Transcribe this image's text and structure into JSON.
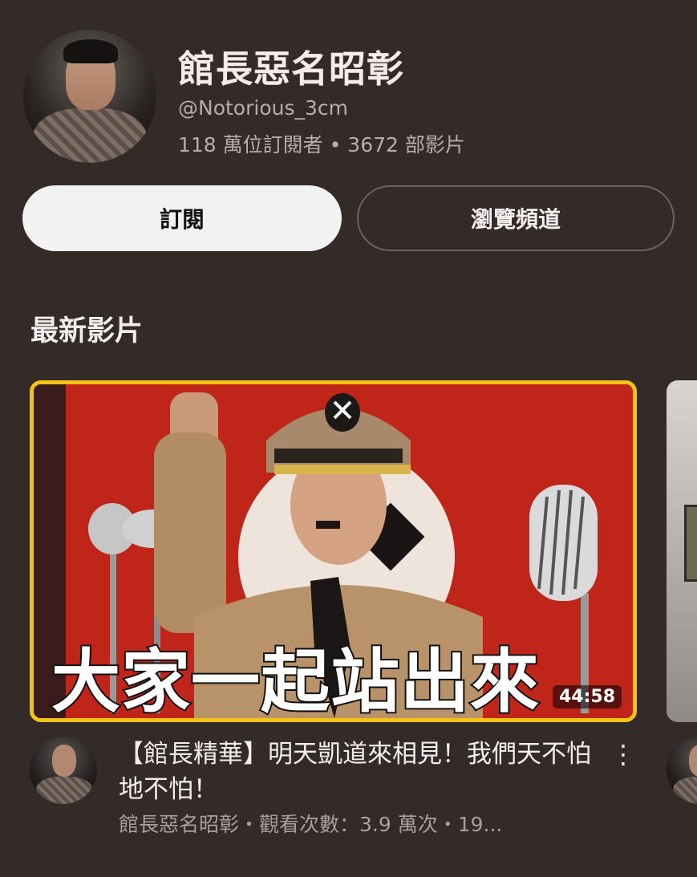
{
  "channel": {
    "name": "館長惡名昭彰",
    "handle": "@Notorious_3cm",
    "stats": "118 萬位訂閱者 • 3672 部影片"
  },
  "buttons": {
    "subscribe": "訂閱",
    "browse": "瀏覽頻道"
  },
  "section": {
    "title": "最新影片"
  },
  "video": {
    "overlay_text": "大家一起站出來",
    "duration": "44:58",
    "title": "【館長精華】明天凱道來相見！我們天不怕地不怕！",
    "meta": "館長惡名昭彰・觀看次數：3.9 萬次・19...",
    "more_icon": "⋮",
    "border_color": "#f3c417"
  },
  "icons": {
    "channel_avatar": "avatar-icon",
    "more": "more-vert-icon"
  },
  "colors": {
    "background": "#342a28",
    "subscribe_bg": "#f2f2f2"
  }
}
